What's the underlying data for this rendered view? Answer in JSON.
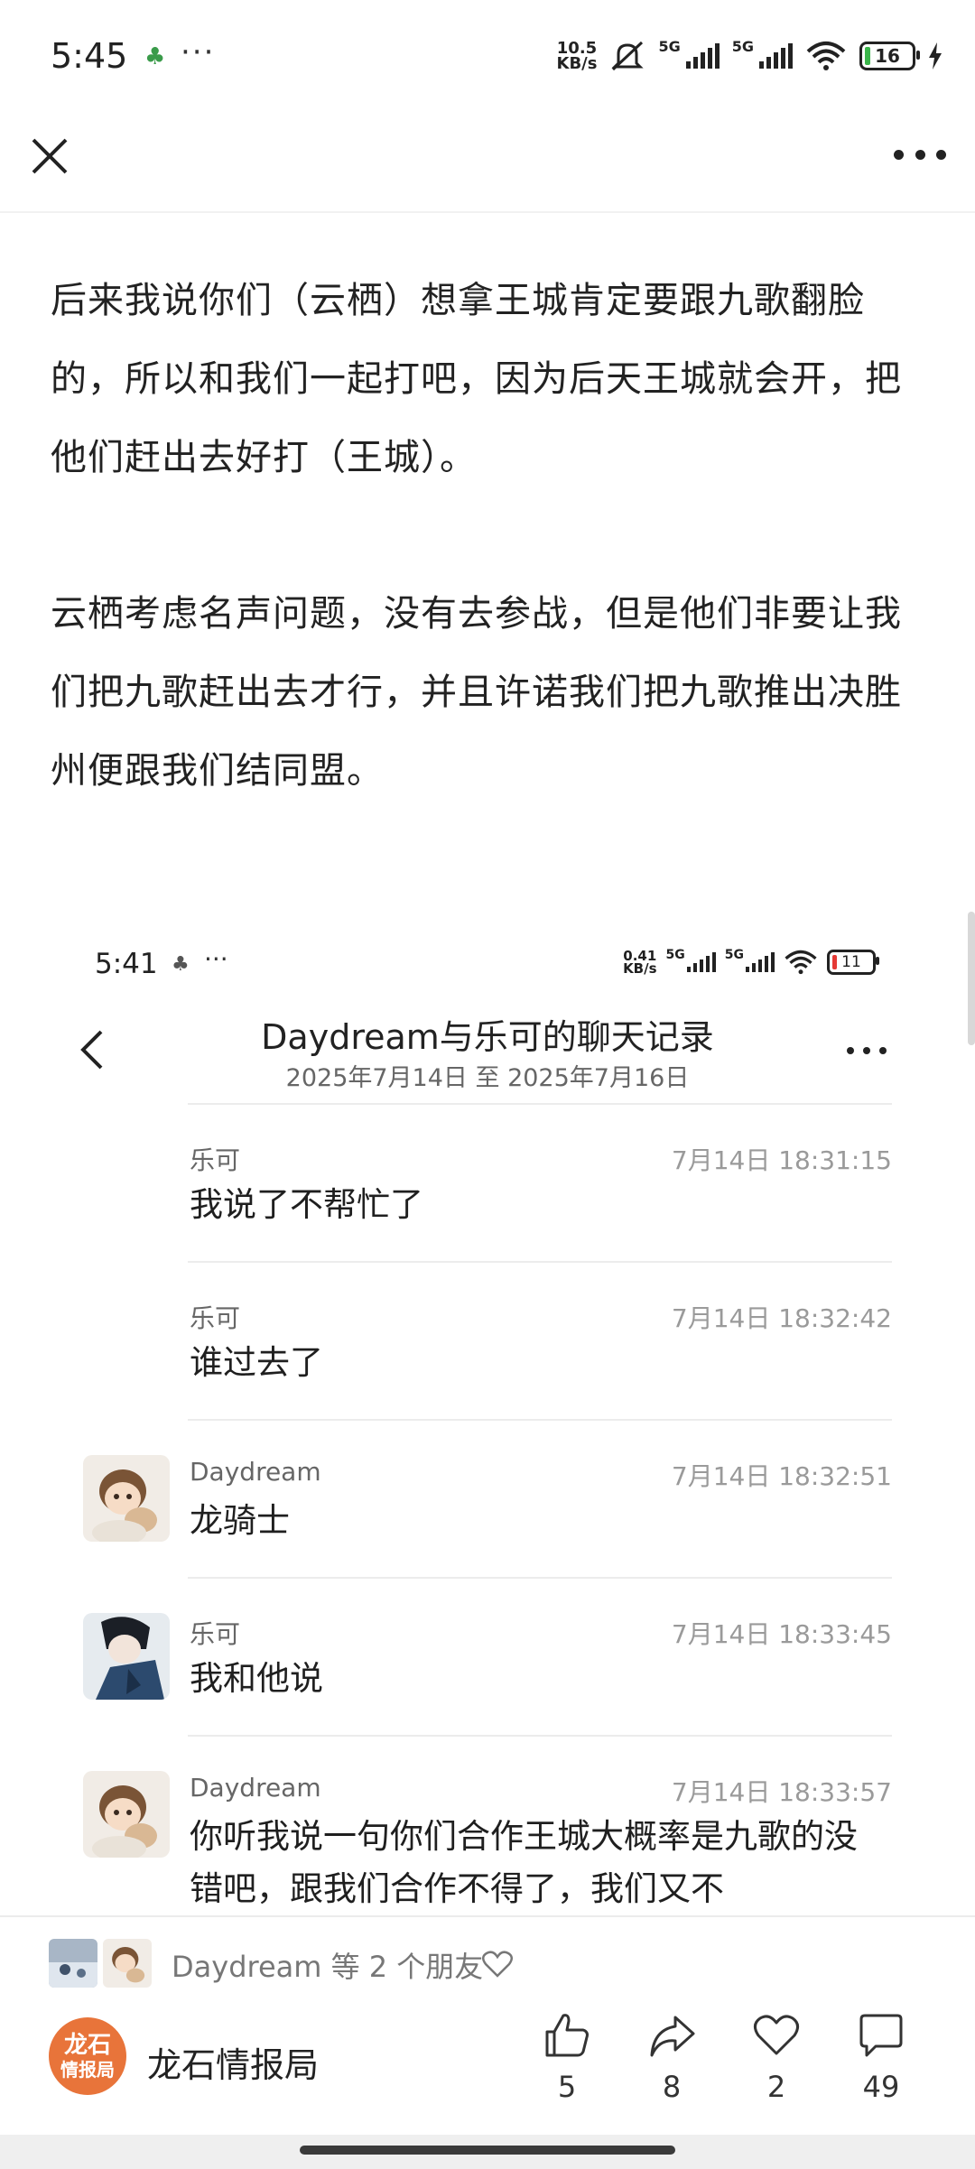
{
  "status_bar": {
    "time": "5:45",
    "app_icon": "app-notification-icon",
    "more": "···",
    "net_speed_value": "10.5",
    "net_speed_unit": "KB/s",
    "sim1": "5G",
    "sim2": "5G",
    "wifi_label": "6",
    "battery": "16"
  },
  "top_nav": {
    "close_icon": "close-icon",
    "more_icon": "more-icon"
  },
  "article": {
    "paragraphs": [
      "后来我说你们（云栖）想拿王城肯定要跟九歌翻脸的，所以和我们一起打吧，因为后天王城就会开，把他们赶出去好打（王城）。",
      "云栖考虑名声问题，没有去参战，但是他们非要让我们把九歌赶出去才行，并且许诺我们把九歌推出决胜州便跟我们结同盟。"
    ]
  },
  "screenshot": {
    "status_bar": {
      "time": "5:41",
      "more": "···",
      "net_speed_value": "0.41",
      "net_speed_unit": "KB/s",
      "sim1": "5G",
      "sim2": "5G",
      "wifi_label": "6",
      "battery": "11"
    },
    "header": {
      "title": "Daydream与乐可的聊天记录",
      "subtitle": "2025年7月14日 至 2025年7月16日"
    },
    "messages": [
      {
        "sender": "乐可",
        "time": "7月14日 18:31:15",
        "text": "我说了不帮忙了",
        "avatar": "none"
      },
      {
        "sender": "乐可",
        "time": "7月14日 18:32:42",
        "text": "谁过去了",
        "avatar": "none"
      },
      {
        "sender": "Daydream",
        "time": "7月14日 18:32:51",
        "text": "龙骑士",
        "avatar": "daydream-avatar"
      },
      {
        "sender": "乐可",
        "time": "7月14日 18:33:45",
        "text": "我和他说",
        "avatar": "leke-avatar"
      },
      {
        "sender": "Daydream",
        "time": "7月14日 18:33:57",
        "text": "你听我说一句你们合作王城大概率是九歌的没错吧，跟我们合作不得了，我们又不",
        "avatar": "daydream-avatar"
      }
    ]
  },
  "friends": {
    "text": "Daydream 等 2 个朋友"
  },
  "author": {
    "logo_text_1": "龙石",
    "logo_text_2": "情报局",
    "name": "龙石情报局"
  },
  "actions": {
    "like": "5",
    "share": "8",
    "favorite": "2",
    "comment": "49"
  },
  "colors": {
    "accent": "#e8743a",
    "battery_green": "#3ab54a",
    "battery_red": "#e53935"
  }
}
